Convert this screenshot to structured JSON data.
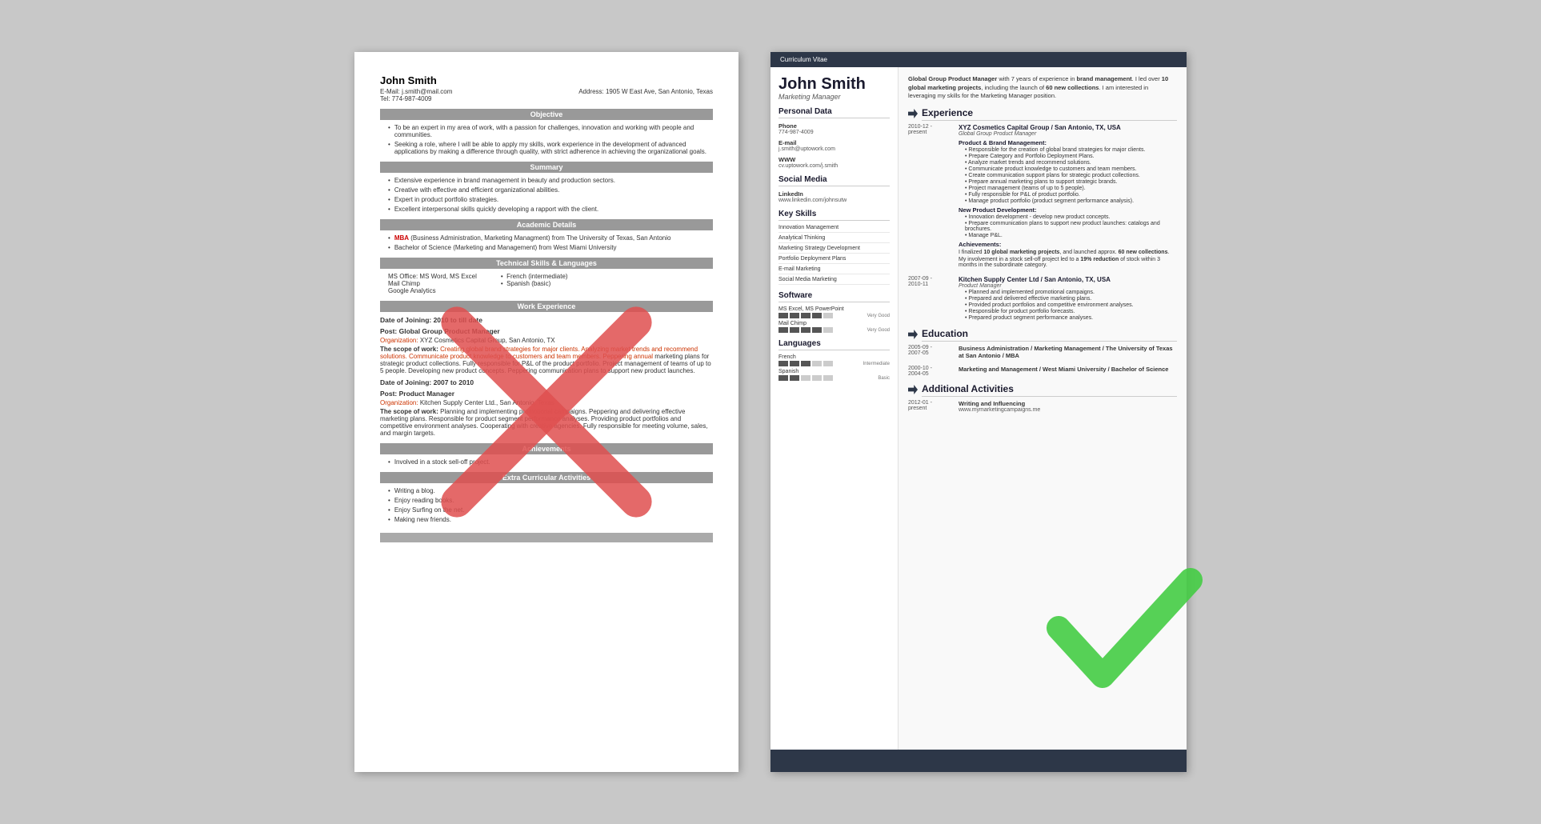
{
  "background_color": "#c8c8c8",
  "left_resume": {
    "name": "John Smith",
    "email": "E-Mail: j.smith@mail.com",
    "address": "Address: 1905 W East Ave, San Antonio, Texas",
    "tel": "Tel: 774-987-4009",
    "sections": {
      "objective": {
        "header": "Objective",
        "bullets": [
          "To be an expert in my area of work, with a passion for challenges, innovation and working with people and communities.",
          "Seeking a role, where I will be able to apply my skills, work experience in the development of advanced applications by making a difference through quality, with strict adherence in achieving the organizational goals."
        ]
      },
      "summary": {
        "header": "Summary",
        "bullets": [
          "Extensive experience in brand management in beauty and production sectors.",
          "Creative with effective and efficient organizational abilities.",
          "Expert in product portfolio strategies.",
          "Excellent interpersonal skills quickly developing a rapport with the client."
        ]
      },
      "academic": {
        "header": "Academic Details",
        "items": [
          "MBA (Business Administration, Marketing Managment) from The University of Texas, San Antonio",
          "Bachelor of Science (Marketing and Management) from West Miami University"
        ]
      },
      "skills": {
        "header": "Technical Skills & Languages",
        "col1": [
          "MS Office: MS Word, MS Excel",
          "Mail Chimp",
          "Google Analytics"
        ],
        "col2": [
          "French (intermediate)",
          "Spanish (basic)"
        ]
      },
      "work": {
        "header": "Work Experience",
        "jobs": [
          {
            "date": "Date of Joining: 2010 to till date",
            "post": "Post: Global Group Product Manager",
            "org": "Organization: XYZ Cosmetics Capital Group, San Antonio, TX",
            "scope": "The scope of work: Creating global brand strategies for major clients. Analyzing market trends and recommend solutions. Communicate product knowledge to customers and team members. Peppering annual marketing plans for strategic product collections. Fully responsible for P&L of the product portfolio. Project management of teams of up to 5 people. Developing new product concepts. Peppering communication plans to support new product launches."
          },
          {
            "date": "Date of Joining: 2007 to 2010",
            "post": "Post: Product Manager",
            "org": "Organization: Kitchen Supply Center Ltd., San Antonio, Texas",
            "scope": "The scope of work: Planning and implementing promotional campaigns. Peppering and delivering effective marketing plans. Responsible for product segment performance analyses. Providing product portfolios and competitive environment analyses. Cooperating with creative agencies. Fully responsible for meeting volume, sales, and margin targets."
          }
        ]
      },
      "achievements": {
        "header": "Achievements",
        "bullets": [
          "Involved in a stock sell-off project."
        ]
      },
      "extra": {
        "header": "Extra Curricular Activities",
        "bullets": [
          "Writing a blog.",
          "Enjoy reading books.",
          "Enjoy Surfing on the net.",
          "Making new friends."
        ]
      }
    }
  },
  "right_resume": {
    "cv_label": "Curriculum Vitae",
    "name": "John Smith",
    "title": "Marketing Manager",
    "personal_data": {
      "section_title": "Personal Data",
      "phone_label": "Phone",
      "phone_value": "774-987-4009",
      "email_label": "E-mail",
      "email_value": "j.smith@uptowork.com",
      "www_label": "WWW",
      "www_value": "cv.uptowork.com/j.smith",
      "social_media_title": "Social Media",
      "linkedin_label": "LinkedIn",
      "linkedin_value": "www.linkedin.com/johnsutw"
    },
    "key_skills": {
      "section_title": "Key Skills",
      "skills": [
        "Innovation Management",
        "Analytical Thinking",
        "Marketing Strategy Development",
        "Portfolio Deployment Plans",
        "E-mail Marketing",
        "Social Media Marketing"
      ]
    },
    "software": {
      "section_title": "Software",
      "items": [
        {
          "name": "MS Excel, MS PowerPoint",
          "filled": 4,
          "total": 5,
          "label": "Very Good"
        },
        {
          "name": "Mail Chimp",
          "filled": 4,
          "total": 5,
          "label": "Very Good"
        }
      ]
    },
    "languages": {
      "section_title": "Languages",
      "items": [
        {
          "name": "French",
          "filled": 3,
          "total": 5,
          "label": "Intermediate"
        },
        {
          "name": "Spanish",
          "filled": 2,
          "total": 5,
          "label": "Basic"
        }
      ]
    },
    "summary_text": "Global Group Product Manager with 7 years of experience in brand management. I led over 10 global marketing projects, including the launch of 60 new collections. I am interested in leveraging my skills for the Marketing Manager position.",
    "experience": {
      "section_title": "Experience",
      "jobs": [
        {
          "date": "2010-12 - present",
          "company": "XYZ Cosmetics Capital Group / San Antonio, TX, USA",
          "role": "Global Group Product Manager",
          "subsections": [
            {
              "title": "Product & Brand Management:",
              "bullets": [
                "Responsible for the creation of global brand strategies for major clients.",
                "Prepare Category and Portfolio Deployment Plans.",
                "Analyze market trends and recommend solutions.",
                "Communicate product knowledge to customers and team members.",
                "Create communication support plans for strategic product collections.",
                "Prepare annual marketing plans to support strategic brands.",
                "Project management (teams of up to 5 people).",
                "Fully responsible for P&L of product portfolio.",
                "Manage product portfolio (product segment performance analysis)."
              ]
            },
            {
              "title": "New Product Development:",
              "bullets": [
                "Innovation development - develop new product concepts.",
                "Prepare communication plans to support new product launches: catalogs and brochures.",
                "Manage P&L."
              ]
            }
          ],
          "achievement_title": "Achievements:",
          "achievement_text": "I finalized 10 global marketing projects, and launched approx. 60 new collections.",
          "achievement_text2": "My involvement in a stock sell-off project led to a 19% reduction of stock within 3 months in the subordinate category."
        },
        {
          "date": "2007-09 - 2010-11",
          "company": "Kitchen Supply Center Ltd / San Antonio, TX, USA",
          "role": "Product Manager",
          "bullets": [
            "Planned and implemented promotional campaigns.",
            "Prepared and delivered effective marketing plans.",
            "Provided product portfolios and competitive environment analyses.",
            "Responsible for product portfolio forecasts.",
            "Prepared product segment performance analyses."
          ]
        }
      ]
    },
    "education": {
      "section_title": "Education",
      "items": [
        {
          "date": "2005-09 - 2007-05",
          "degree": "Business Administration / Marketing Management / The University of Texas at San Antonio / MBA"
        },
        {
          "date": "2000-10 - 2004-05",
          "degree": "Marketing and Management / West Miami University / Bachelor of Science"
        }
      ]
    },
    "additional": {
      "section_title": "Additional Activities",
      "items": [
        {
          "date": "2012-01 - present",
          "activity": "Writing and Influencing",
          "link": "www.mymarketingcampaigns.me"
        }
      ]
    }
  }
}
